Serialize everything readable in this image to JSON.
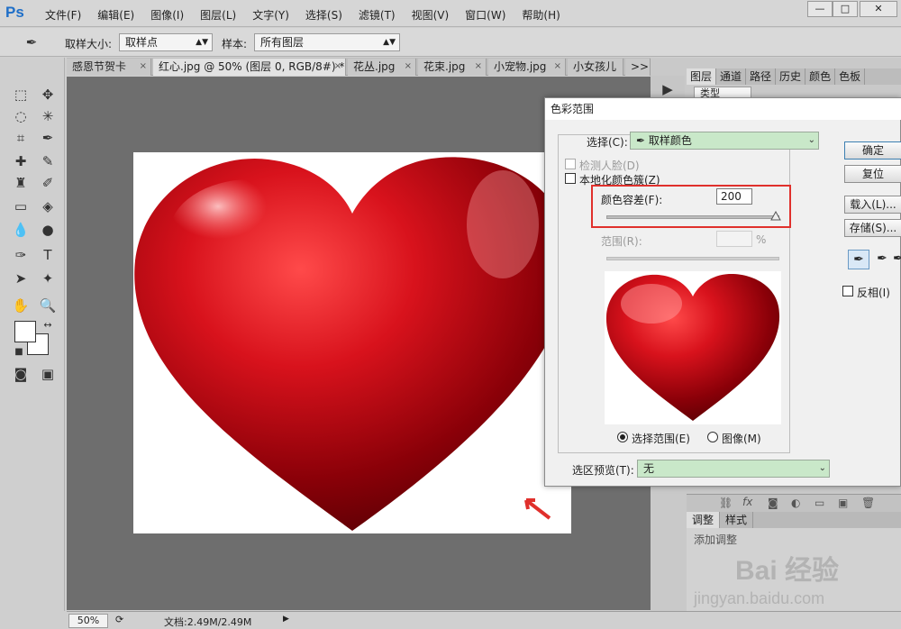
{
  "app": {
    "logo": "Ps"
  },
  "menubar": {
    "items": [
      "文件(F)",
      "编辑(E)",
      "图像(I)",
      "图层(L)",
      "文字(Y)",
      "选择(S)",
      "滤镜(T)",
      "视图(V)",
      "窗口(W)",
      "帮助(H)"
    ],
    "min": "—",
    "max": "□",
    "close": "✕"
  },
  "options": {
    "sample_size_label": "取样大小:",
    "sample_size_value": "取样点",
    "sample_label": "样本:",
    "sample_value": "所有图层"
  },
  "tabs": [
    {
      "label": "感恩节贺卡"
    },
    {
      "label": "红心.jpg @ 50% (图层 0, RGB/8#) *"
    },
    {
      "label": "花丛.jpg"
    },
    {
      "label": "花束.jpg"
    },
    {
      "label": "小宠物.jpg"
    },
    {
      "label": "小女孩儿"
    }
  ],
  "tabs_more": ">>",
  "panel_tabs": [
    "图层",
    "通道",
    "路径",
    "历史",
    "颜色",
    "色板"
  ],
  "layers_filter": "类型",
  "adj_tabs": [
    "调整",
    "样式"
  ],
  "adj_title": "添加调整",
  "status": {
    "zoom": "50%",
    "doc": "文档:2.49M/2.49M"
  },
  "dialog": {
    "title": "色彩范围",
    "select_label": "选择(C):",
    "select_value": "取样颜色",
    "detect_faces": "检测人脸(D)",
    "localized": "本地化颜色簇(Z)",
    "fuzziness_label": "颜色容差(F):",
    "fuzziness_value": "200",
    "fuzziness_level": 1.0,
    "range_label": "范围(R):",
    "range_unit": "%",
    "radio_selection": "选择范围(E)",
    "radio_image": "图像(M)",
    "preview_label": "选区预览(T):",
    "preview_value": "无",
    "ok": "确定",
    "reset": "复位",
    "load": "载入(L)...",
    "save": "存储(S)...",
    "invert": "反相(I)"
  },
  "watermark": {
    "brand": "Bai 经验",
    "url": "jingyan.baidu.com"
  },
  "colors": {
    "highlight": "#e0302c",
    "combo_bg": "#c9e8c9",
    "canvas_bg": "#6e6e6e",
    "heart": "#c8101a"
  }
}
